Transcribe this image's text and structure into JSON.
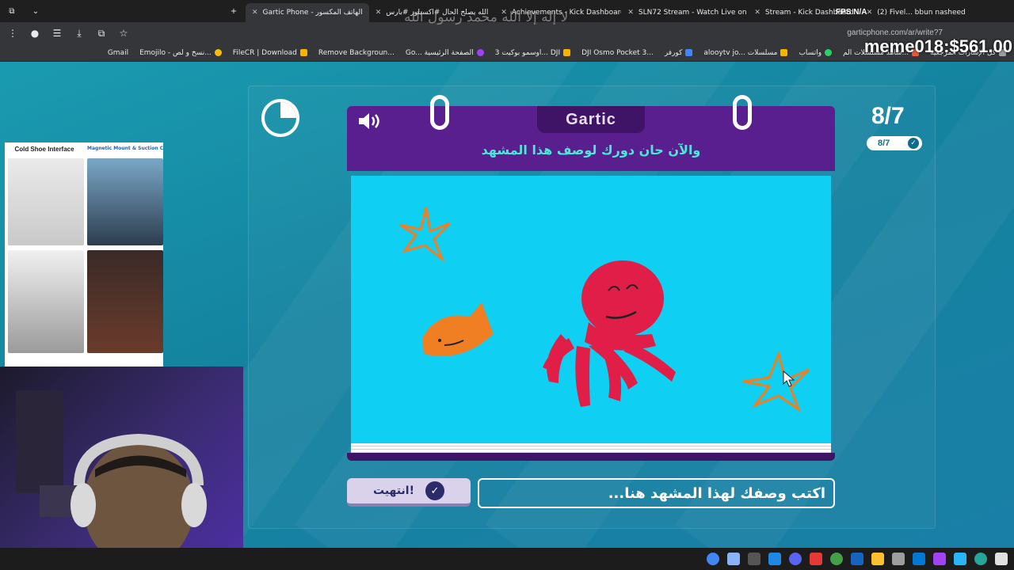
{
  "browser": {
    "tabs": [
      {
        "label": "Gartic Phone - الهاتف المكسور",
        "active": true
      },
      {
        "label": "الله يصلح الحال #اكسبلور #بارس",
        "active": false
      },
      {
        "label": "Achievements - Kick Dashboard",
        "active": false
      },
      {
        "label": "SLN72 Stream - Watch Live on",
        "active": false
      },
      {
        "label": "Stream - Kick Dashboard",
        "active": false
      },
      {
        "label": "(2) Fivel... bbun nasheed",
        "active": false
      }
    ],
    "url": "garticphone.com/ar/write?7",
    "bookmarks": [
      {
        "label": "كل الإشارات المرجعية",
        "color": "#9aa0a6"
      },
      {
        "label": "شاهد مسلسلات الم...",
        "color": "#e8593c"
      },
      {
        "label": "واتساب",
        "color": "#25d366"
      },
      {
        "label": "alooytv jo... مسلسلات",
        "color": "#f4b400"
      },
      {
        "label": "كورفر",
        "color": "#4285f4"
      },
      {
        "label": "DJI Osmo Pocket 3...",
        "color": "#333333"
      },
      {
        "label": "اوسمو بوكيت 3... DJI",
        "color": "#f4b400"
      },
      {
        "label": "Go... الصفحة الرئيسية",
        "color": "#a142f4"
      },
      {
        "label": "Remove Backgroun...",
        "color": "#e94235"
      },
      {
        "label": "FileCR | Download",
        "color": "#f4b400"
      },
      {
        "label": "Emojilo - نسخ و لص...",
        "color": "#fbbc04"
      },
      {
        "label": "Gmail",
        "color": "#ea4335"
      }
    ]
  },
  "overlays": {
    "money": "meme018:$561.00",
    "arabic_banner": "لا إله إلا الله محمد رسول الله",
    "fps": "FPS N/A"
  },
  "game": {
    "logo": "Gartic",
    "instruction": "والآن حان دورك لوصف هذا المشهد",
    "round_big": "8/7",
    "round_small": "8/7",
    "done_label": "انتهيت!",
    "input_placeholder": "اكتب وصفك لهذا المشهد هنا...",
    "timer_fraction": 0.25
  },
  "ad": {
    "title": "Cold Shoe Interface",
    "subtitle": "Magnetic Mount & Suction Cup Base"
  },
  "colors": {
    "page_bg": "#1a8fb0",
    "book_purple": "#5a1f8f",
    "canvas_bg": "#0fd0f2",
    "instruction_text": "#4ee6d6",
    "octopus": "#e01e48",
    "fish": "#f07e22"
  }
}
